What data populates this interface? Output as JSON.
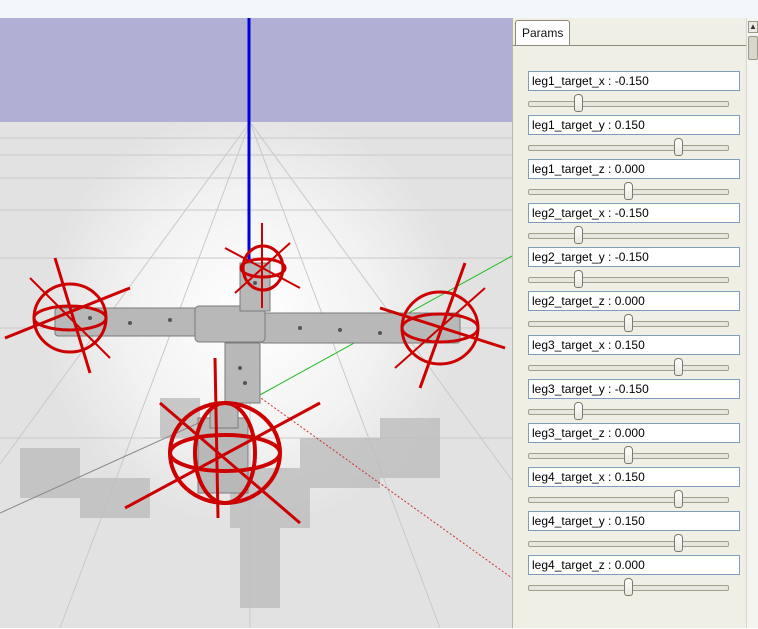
{
  "panel": {
    "tab_label": "Params"
  },
  "params": [
    {
      "label": "leg1_target_x : -0.150",
      "value": -0.15
    },
    {
      "label": "leg1_target_y : 0.150",
      "value": 0.15
    },
    {
      "label": "leg1_target_z : 0.000",
      "value": 0.0
    },
    {
      "label": "leg2_target_x : -0.150",
      "value": -0.15
    },
    {
      "label": "leg2_target_y : -0.150",
      "value": -0.15
    },
    {
      "label": "leg2_target_z : 0.000",
      "value": 0.0
    },
    {
      "label": "leg3_target_x : 0.150",
      "value": 0.15
    },
    {
      "label": "leg3_target_y : -0.150",
      "value": -0.15
    },
    {
      "label": "leg3_target_z : 0.000",
      "value": 0.0
    },
    {
      "label": "leg4_target_x : 0.150",
      "value": 0.15
    },
    {
      "label": "leg4_target_y : 0.150",
      "value": 0.15
    },
    {
      "label": "leg4_target_z : 0.000",
      "value": 0.0
    }
  ],
  "slider_range": [
    -0.3,
    0.3
  ],
  "colors": {
    "sky": "#b1b0d4",
    "ground": "#e6e6e6",
    "target_marker": "#cc0000",
    "axis_z": "#0000dd",
    "axis_y": "#22bb22",
    "robot": "#b8b8b8"
  }
}
